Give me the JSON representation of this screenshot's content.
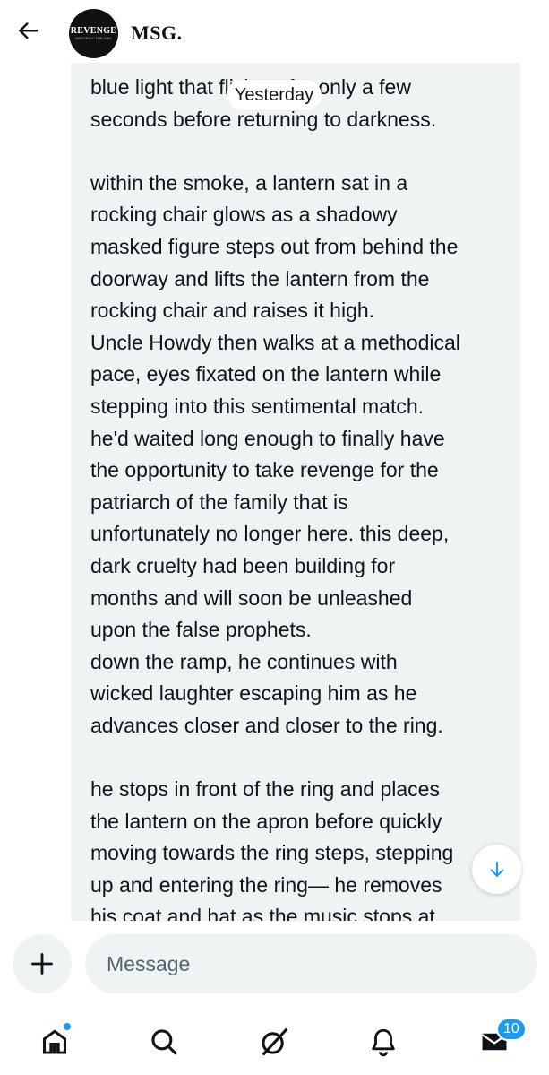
{
  "header": {
    "title": "MSG.",
    "avatar_text": "REVENGE",
    "avatar_subtext": "DESTROY THE DAY"
  },
  "conversation": {
    "date_separator": "Yesterday",
    "message_text": "blue light that flickers for only a few\nseconds before returning to darkness.\n\nwithin the smoke, a lantern sat in a\nrocking chair glows as a shadowy\nmasked figure steps out from behind the\ndoorway and lifts the lantern from the\nrocking chair and raises it high.\nUncle Howdy then walks at a methodical\npace, eyes fixated on the lantern while\nstepping into this sentimental match.\nhe'd waited long enough to finally have\nthe opportunity to take revenge for the\npatriarch of the family that is\nunfortunately no longer here. this deep,\ndark cruelty had been building for\nmonths and will soon be unleashed\nupon the false prophets.\ndown the ramp, he continues with\nwicked laughter escaping him as he\nadvances closer and closer to the ring.\n\nhe stops in front of the ring and places\nthe lantern on the apron before quickly\nmoving towards the ring steps, stepping\nup and entering the ring— he removes\nhis coat and hat as the music stops at"
  },
  "composer": {
    "placeholder": "Message",
    "value": ""
  },
  "nav": {
    "items": [
      {
        "icon": "home-icon",
        "has_dot": true
      },
      {
        "icon": "search-icon"
      },
      {
        "icon": "grok-icon"
      },
      {
        "icon": "bell-icon"
      },
      {
        "icon": "mail-icon",
        "badge": "10"
      }
    ]
  },
  "colors": {
    "accent": "#1d9bf0",
    "bubble": "#eff3f4",
    "text": "#0f1419",
    "placeholder": "#536471"
  }
}
